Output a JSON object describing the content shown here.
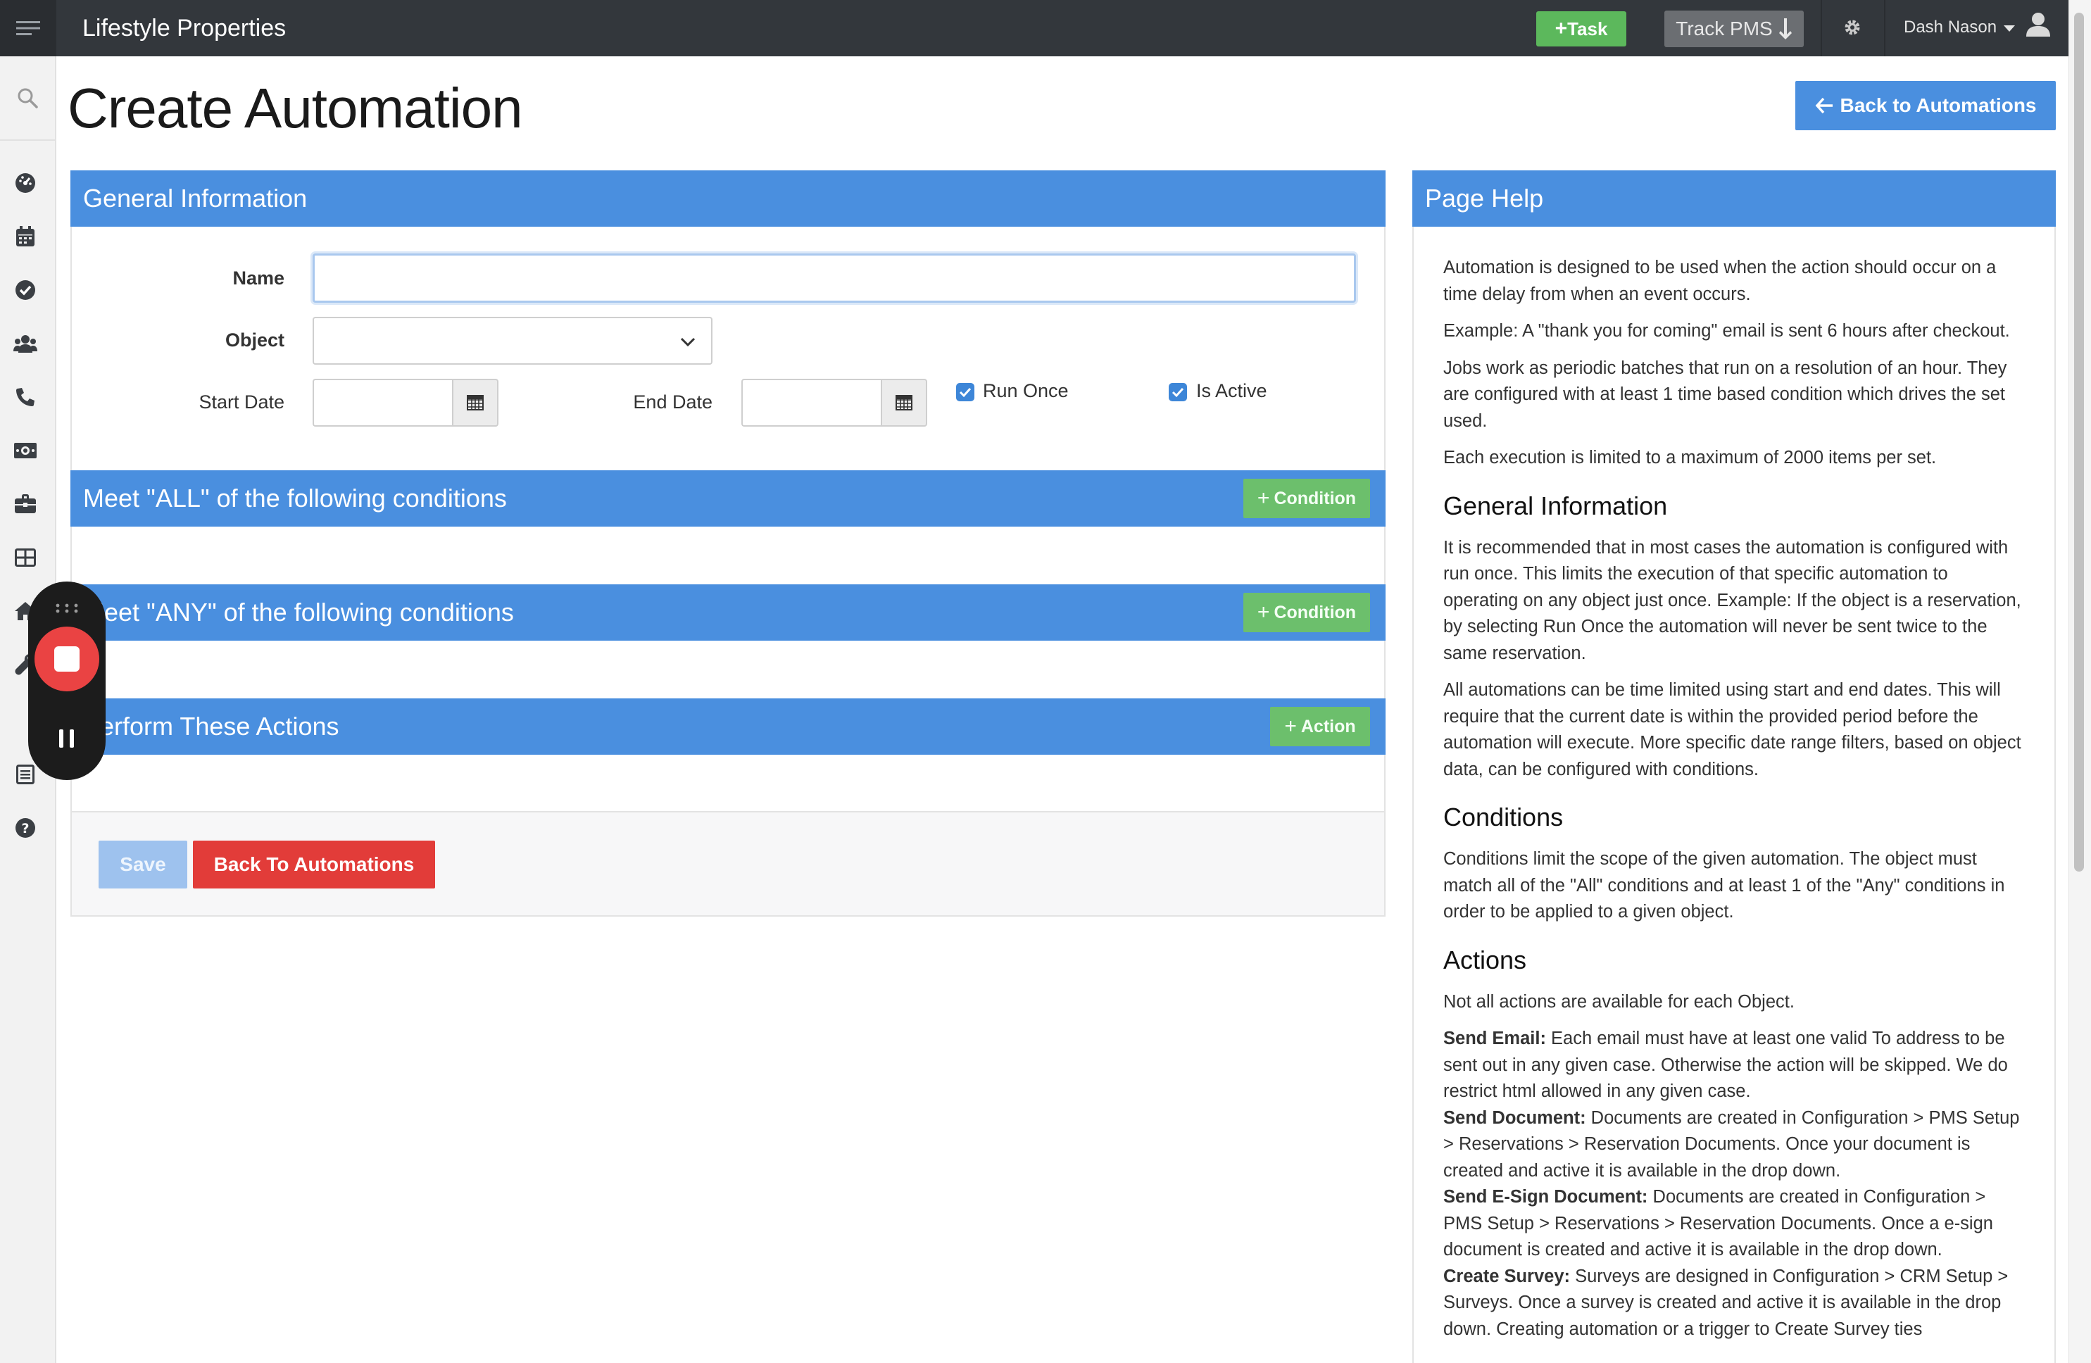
{
  "header": {
    "app_title": "Lifestyle Properties",
    "task_label": "Task",
    "track_label": "Track PMS",
    "user_name": "Dash Nason"
  },
  "page": {
    "title": "Create Automation",
    "back_to_automations_label": "Back to Automations"
  },
  "general": {
    "title": "General Information",
    "name_label": "Name",
    "name_value": "",
    "object_label": "Object",
    "object_value": "",
    "start_date_label": "Start Date",
    "end_date_label": "End Date",
    "run_once_label": "Run Once",
    "run_once_checked": true,
    "is_active_label": "Is Active",
    "is_active_checked": true
  },
  "sections": {
    "all_title": "Meet \"ALL\" of the following conditions",
    "any_title": "Meet \"ANY\" of the following conditions",
    "actions_title": "Perform These Actions",
    "condition_label": "Condition",
    "action_label": "Action"
  },
  "footer": {
    "save_label": "Save",
    "back_label": "Back To Automations"
  },
  "help": {
    "title": "Page Help",
    "p1": "Automation is designed to be used when the action should occur on a time delay from when an event occurs.",
    "p2": "Example: A \"thank you for coming\" email is sent 6 hours after checkout.",
    "p3": "Jobs work as periodic batches that run on a resolution of an hour. They are configured with at least 1 time based condition which drives the set used.",
    "p4": "Each execution is limited to a maximum of 2000 items per set.",
    "h_general": "General Information",
    "p5": "It is recommended that in most cases the automation is configured with run once. This limits the execution of that specific automation to operating on any object just once. Example: If the object is a reservation, by selecting Run Once the automation will never be sent twice to the same reservation.",
    "p6": "All automations can be time limited using start and end dates. This will require that the current date is within the provided period before the automation will execute. More specific date range filters, based on object data, can be configured with conditions.",
    "h_conditions": "Conditions",
    "p7": "Conditions limit the scope of the given automation. The object must match all of the \"All\" conditions and at least 1 of the \"Any\" conditions in order to be applied to a given object.",
    "h_actions": "Actions",
    "p8": "Not all actions are available for each Object.",
    "a1_title": "Send Email:",
    "a1_text": " Each email must have at least one valid To address to be sent out in any given case. Otherwise the action will be skipped. We do restrict html allowed in any given case.",
    "a2_title": "Send Document:",
    "a2_text": " Documents are created in Configuration > PMS Setup > Reservations > Reservation Documents. Once your document is created and active it is available in the drop down.",
    "a3_title": "Send E-Sign Document:",
    "a3_text": " Documents are created in Configuration > PMS Setup > Reservations > Reservation Documents. Once a e-sign document is created and active it is available in the drop down.",
    "a4_title": "Create Survey:",
    "a4_text": " Surveys are designed in Configuration > CRM Setup > Surveys. Once a survey is created and active it is available in the drop down. Creating automation or a trigger to Create Survey ties"
  },
  "colors": {
    "topbar": "#33373c",
    "primary": "#4a8fdf",
    "success": "#5cb85c",
    "danger": "#e23c39"
  }
}
